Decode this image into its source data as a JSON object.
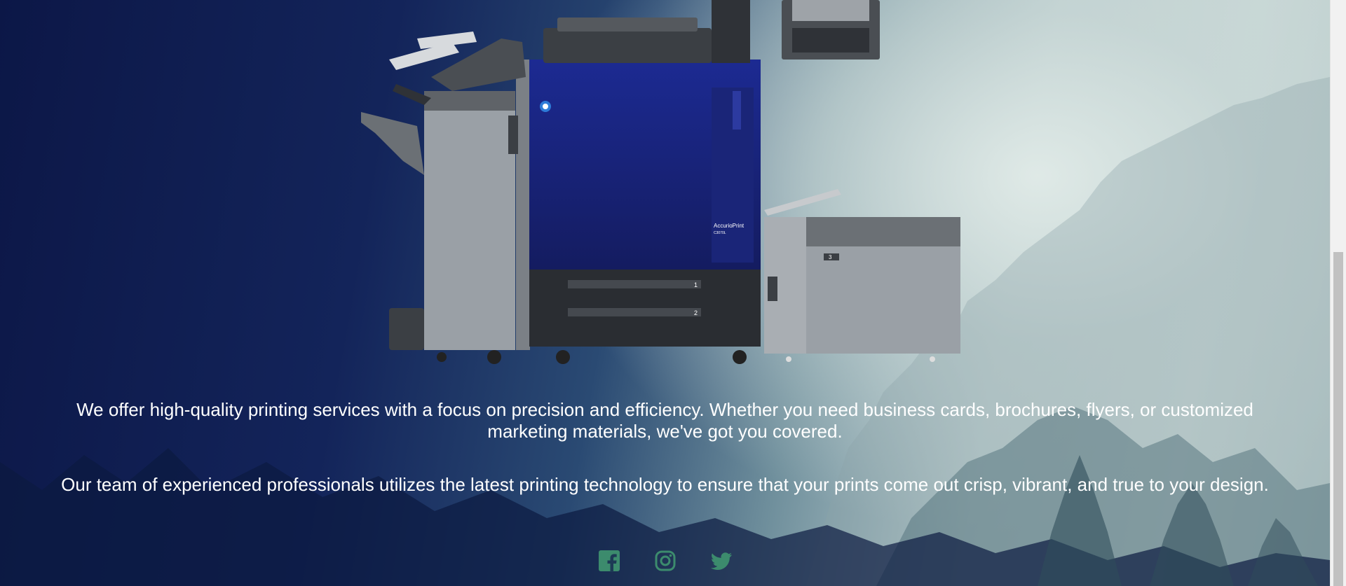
{
  "hero": {
    "image_alt": "Konica Minolta AccurioPrint production printer"
  },
  "about": {
    "paragraph_1": "We offer high-quality printing services with a focus on precision and efficiency. Whether you need business cards, brochures, flyers, or customized marketing materials, we've got you covered.",
    "paragraph_2": "Our team of experienced professionals utilizes the latest printing technology to ensure that your prints come out crisp, vibrant, and true to your design."
  },
  "social": {
    "icons": [
      "facebook-icon",
      "instagram-icon",
      "twitter-icon"
    ],
    "accent_color": "#3c8b6d"
  },
  "printer_labels": {
    "model": "AccurioPrint",
    "model_sub": "C3070L",
    "tray_1": "1",
    "tray_2": "2",
    "tray_3": "3"
  }
}
